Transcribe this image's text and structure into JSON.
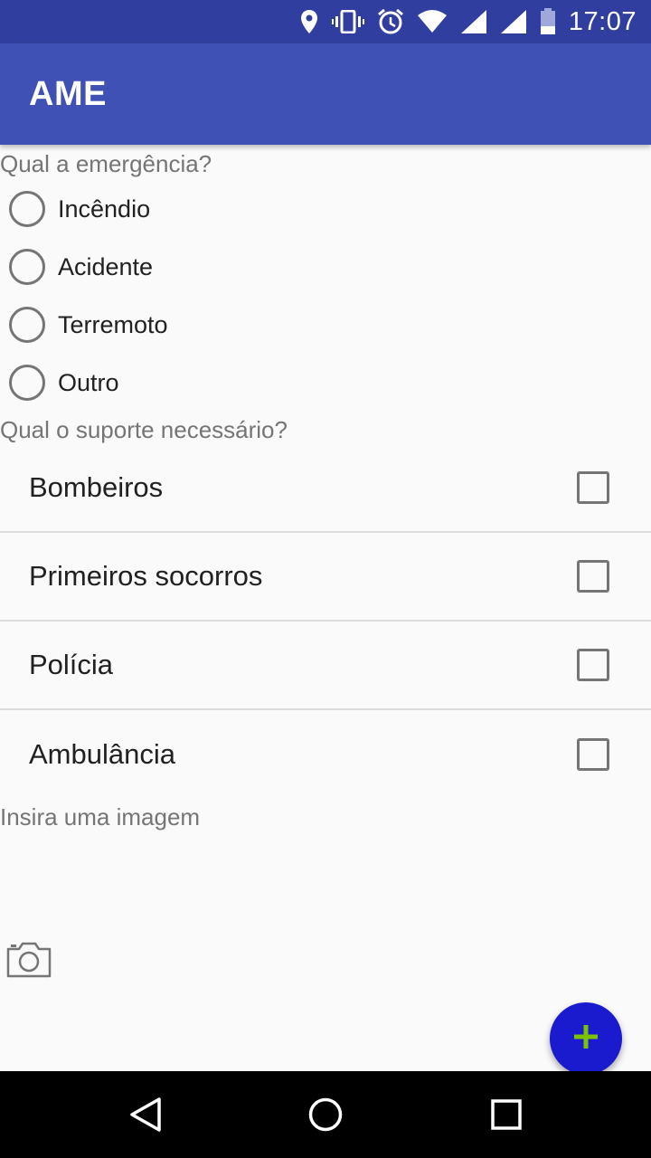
{
  "status_bar": {
    "time": "17:07",
    "icons": [
      "location-icon",
      "vibrate-icon",
      "alarm-icon",
      "wifi-icon",
      "signal-icon",
      "signal-icon",
      "battery-icon"
    ]
  },
  "app_bar": {
    "title": "AME"
  },
  "emergency": {
    "question": "Qual a emergência?",
    "options": [
      {
        "label": "Incêndio",
        "selected": false
      },
      {
        "label": "Acidente",
        "selected": false
      },
      {
        "label": "Terremoto",
        "selected": false
      },
      {
        "label": "Outro",
        "selected": false
      }
    ]
  },
  "support": {
    "question": "Qual o suporte necessário?",
    "options": [
      {
        "label": "Bombeiros",
        "checked": false
      },
      {
        "label": "Primeiros socorros",
        "checked": false
      },
      {
        "label": "Polícia",
        "checked": false
      },
      {
        "label": "Ambulância",
        "checked": false
      }
    ]
  },
  "image": {
    "prompt": "Insira uma imagem",
    "icon": "camera-icon"
  },
  "fab": {
    "icon": "plus-icon",
    "color": "#1a1acf",
    "icon_color": "#7cc400"
  },
  "colors": {
    "status_bar": "#303f9f",
    "primary": "#3f51b5",
    "background": "#fafafa",
    "secondary_text": "#757575"
  },
  "nav_bar": {
    "icons": [
      "back-icon",
      "home-icon",
      "recents-icon"
    ]
  }
}
